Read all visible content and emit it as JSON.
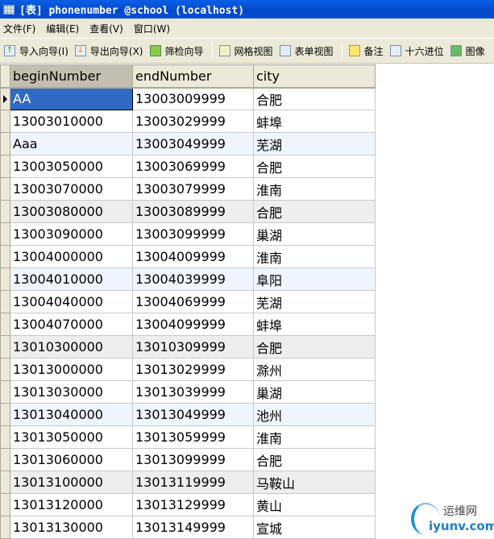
{
  "window": {
    "title": "[表] phonenumber @school (localhost)"
  },
  "menu": [
    "文件(F)",
    "编辑(E)",
    "查看(V)",
    "窗口(W)"
  ],
  "toolbar": [
    {
      "label": "导入向导(I)",
      "icon": "import-icon"
    },
    {
      "label": "导出向导(X)",
      "icon": "export-icon"
    },
    {
      "label": "筛检向导",
      "icon": "filter-icon"
    },
    {
      "label": "网格视图",
      "icon": "grid-view-icon"
    },
    {
      "label": "表单视图",
      "icon": "form-view-icon"
    },
    {
      "label": "备注",
      "icon": "memo-icon"
    },
    {
      "label": "十六进位",
      "icon": "hex-icon"
    },
    {
      "label": "图像",
      "icon": "image-icon"
    }
  ],
  "table": {
    "columns": [
      "beginNumber",
      "endNumber",
      "city"
    ],
    "rows": [
      [
        "AA",
        "13003009999",
        "合肥"
      ],
      [
        "13003010000",
        "13003029999",
        "蚌埠"
      ],
      [
        "Aaa",
        "13003049999",
        "芜湖"
      ],
      [
        "13003050000",
        "13003069999",
        "合肥"
      ],
      [
        "13003070000",
        "13003079999",
        "淮南"
      ],
      [
        "13003080000",
        "13003089999",
        "合肥"
      ],
      [
        "13003090000",
        "13003099999",
        "巢湖"
      ],
      [
        "13004000000",
        "13004009999",
        "淮南"
      ],
      [
        "13004010000",
        "13004039999",
        "阜阳"
      ],
      [
        "13004040000",
        "13004069999",
        "芜湖"
      ],
      [
        "13004070000",
        "13004099999",
        "蚌埠"
      ],
      [
        "13010300000",
        "13010309999",
        "合肥"
      ],
      [
        "13013000000",
        "13013029999",
        "滁州"
      ],
      [
        "13013030000",
        "13013039999",
        "巢湖"
      ],
      [
        "13013040000",
        "13013049999",
        "池州"
      ],
      [
        "13013050000",
        "13013059999",
        "淮南"
      ],
      [
        "13013060000",
        "13013099999",
        "合肥"
      ],
      [
        "13013100000",
        "13013119999",
        "马鞍山"
      ],
      [
        "13013120000",
        "13013129999",
        "黄山"
      ],
      [
        "13013130000",
        "13013149999",
        "宣城"
      ]
    ]
  },
  "watermark": {
    "line1": "运维网",
    "line2": "iyunv.com"
  }
}
